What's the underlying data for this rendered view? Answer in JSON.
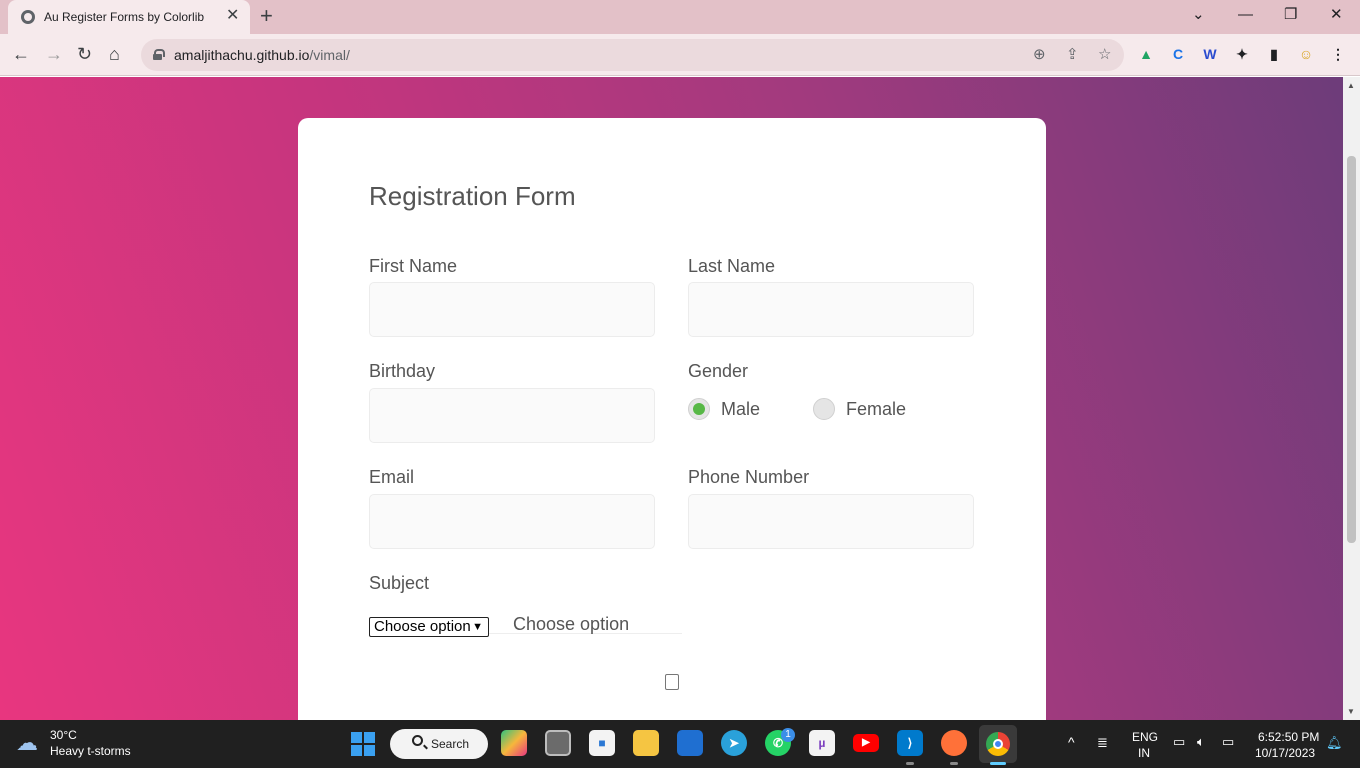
{
  "browser": {
    "tab_title": "Au Register Forms by Colorlib",
    "tab_close": "✕",
    "new_tab": "+",
    "url_host": "amaljithachu.github.io",
    "url_path": "/vimal/",
    "window": {
      "tabs_menu": "⌄",
      "minimize": "—",
      "restore": "❐",
      "close": "✕"
    },
    "nav": {
      "back": "←",
      "forward": "→",
      "reload": "↻",
      "home": "⌂"
    },
    "omnibox_icons": {
      "zoom": "⊕",
      "share": "⇪",
      "bookmark": "☆"
    },
    "extensions": {
      "drive": "▲",
      "edge": "C",
      "word": "W",
      "puzzle": "✦",
      "sidepanel": "▮",
      "profile": "☺",
      "menu": "⋮"
    }
  },
  "form": {
    "title": "Registration Form",
    "first_name_label": "First Name",
    "first_name_value": "",
    "last_name_label": "Last Name",
    "last_name_value": "",
    "birthday_label": "Birthday",
    "birthday_value": "",
    "gender_label": "Gender",
    "gender_options": [
      "Male",
      "Female"
    ],
    "gender_selected": "Male",
    "email_label": "Email",
    "email_value": "",
    "phone_label": "Phone Number",
    "phone_value": "",
    "subject_label": "Subject",
    "subject_select_value": "Choose option",
    "subject_display": "Choose option",
    "accent_color": "#57b846"
  },
  "taskbar": {
    "weather_temp": "30°C",
    "weather_desc": "Heavy t-storms",
    "search_label": "Search",
    "whatsapp_badge": "1",
    "lang": "ENG",
    "region": "IN",
    "time": "6:52:50 PM",
    "date": "10/17/2023",
    "apps": [
      "copilot",
      "task-view",
      "store",
      "file-explorer",
      "outlook",
      "telegram",
      "whatsapp",
      "utorrent",
      "youtube",
      "vscode",
      "firefox",
      "chrome"
    ]
  }
}
